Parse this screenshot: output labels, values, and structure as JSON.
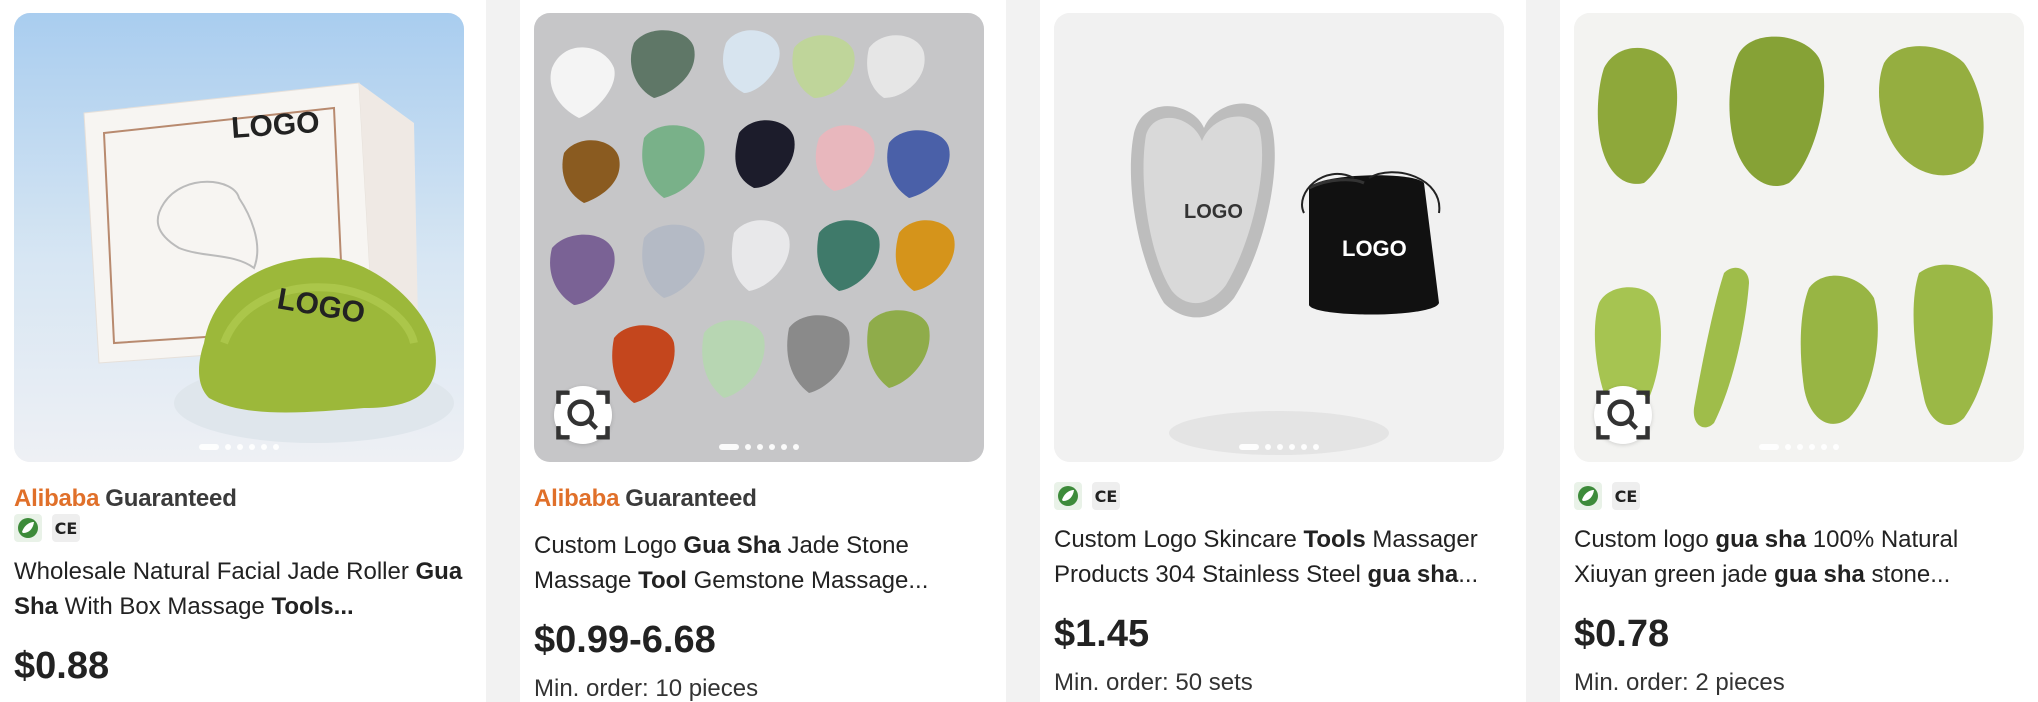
{
  "brand": {
    "alibaba": "Alibaba",
    "guaranteed": "Guaranteed",
    "alibaba_color": "#e0702a"
  },
  "icons": {
    "rohs": "rohs-certification-icon",
    "ce": "CE",
    "lens": "visual-search-icon"
  },
  "products": [
    {
      "title_parts": [
        {
          "t": "Wholesale Natural Facial Jade Roller ",
          "b": false
        },
        {
          "t": "Gua Sha",
          "b": true
        },
        {
          "t": " With Box Massage ",
          "b": false
        },
        {
          "t": "Tools",
          "b": true
        },
        {
          "t": "...",
          "b": true
        }
      ],
      "price": "$0.88",
      "moq": "",
      "guaranteed": true,
      "lens": false
    },
    {
      "title_parts": [
        {
          "t": "Custom Logo ",
          "b": false
        },
        {
          "t": "Gua Sha",
          "b": true
        },
        {
          "t": " Jade Stone Massage ",
          "b": false
        },
        {
          "t": "Tool",
          "b": true
        },
        {
          "t": " Gemstone Massage...",
          "b": false
        }
      ],
      "price": "$0.99-6.68",
      "moq": "Min. order: 10 pieces",
      "guaranteed": true,
      "lens": true
    },
    {
      "title_parts": [
        {
          "t": "Custom Logo Skincare ",
          "b": false
        },
        {
          "t": "Tools",
          "b": true
        },
        {
          "t": " Massager Products 304 Stainless Steel ",
          "b": false
        },
        {
          "t": "gua sha",
          "b": true
        },
        {
          "t": "...",
          "b": false
        }
      ],
      "price": "$1.45",
      "moq": "Min. order: 50 sets",
      "guaranteed": false,
      "lens": false
    },
    {
      "title_parts": [
        {
          "t": "Custom logo ",
          "b": false
        },
        {
          "t": "gua sha",
          "b": true
        },
        {
          "t": " 100% Natural Xiuyan green jade ",
          "b": false
        },
        {
          "t": "gua sha",
          "b": true
        },
        {
          "t": " stone...",
          "b": false
        }
      ],
      "price": "$0.78",
      "moq": "Min. order: 2 pieces",
      "guaranteed": false,
      "lens": true
    }
  ]
}
